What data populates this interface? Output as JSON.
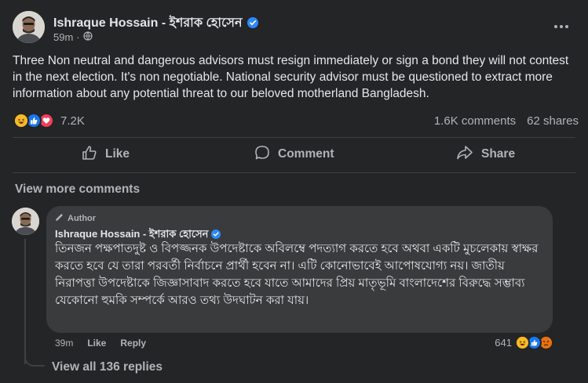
{
  "post": {
    "author": "Ishraque Hossain - ইশরাক হোসেন",
    "time": "59m",
    "privacy_icon": "globe-icon",
    "text": "Three Non neutral and dangerous advisors  must resign immediately or sign a bond they will not contest in the next election. It's non negotiable. National security advisor must be questioned to extract more information about any potential threat to our beloved motherland Bangladesh.",
    "reactions": [
      "haha",
      "like",
      "love"
    ],
    "reaction_count": "7.2K",
    "comments_count": "1.6K comments",
    "shares_count": "62 shares"
  },
  "actions": {
    "like": "Like",
    "comment": "Comment",
    "share": "Share"
  },
  "view_more_comments": "View more comments",
  "comment": {
    "badge": "Author",
    "author": "Ishraque Hossain - ইশরাক হোসেন",
    "text": "তিনজন পক্ষপাতদুষ্ট ও বিপজ্জনক উপদেষ্টাকে অবিলম্বে পদত্যাগ করতে হবে অথবা একটি মুচলেকায় স্বাক্ষর করতে হবে যে তারা পরবর্তী নির্বাচনে প্রার্থী হবেন না। এটি কোনোভাবেই আপোষযোগ্য নয়। জাতীয় নিরাপত্তা উপদেষ্টাকে জিজ্ঞাসাবাদ করতে হবে যাতে আমাদের প্রিয় মাতৃভূমি বাংলাদেশের বিরুদ্ধে সম্ভাব্য যেকোনো হুমকি সম্পর্কে আরও তথ্য উদঘাটন করা যায়।",
    "time": "39m",
    "like": "Like",
    "reply": "Reply",
    "reaction_count": "641",
    "reactions": [
      "haha",
      "like",
      "angry"
    ]
  },
  "view_replies": "View all 136 replies",
  "colors": {
    "background": "#242526",
    "bubble": "#3a3b3c",
    "text_primary": "#e4e6eb",
    "text_secondary": "#b0b3b8",
    "verified": "#2d88ff"
  }
}
